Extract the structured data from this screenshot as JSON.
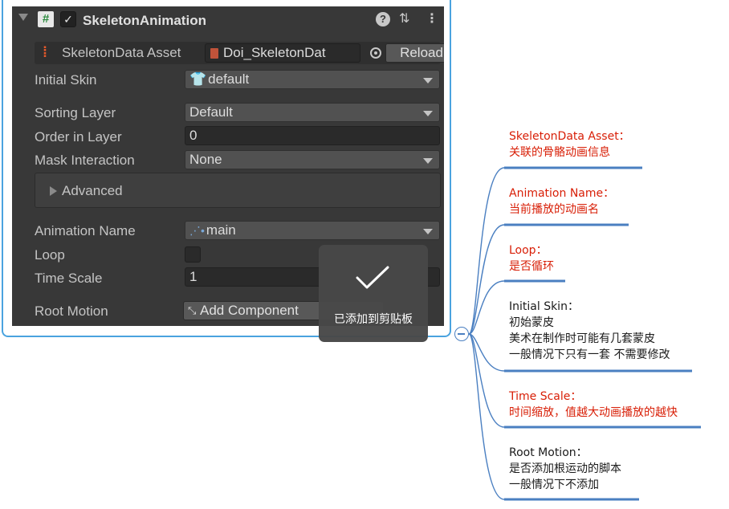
{
  "inspector": {
    "component_title": "SkeletonAnimation",
    "script_icon_glyph": "#",
    "enable_check_glyph": "✓",
    "help_icon_glyph": "?",
    "preset_icon_glyph": "⇅",
    "menu_icon_glyph": "⋮",
    "asset_row": {
      "label": "SkeletonData Asset",
      "value": "Doi_SkeletonDat",
      "reload_label": "Reload"
    },
    "initial_skin": {
      "label": "Initial Skin",
      "value": "default"
    },
    "sorting_layer": {
      "label": "Sorting Layer",
      "value": "Default"
    },
    "order_in_layer": {
      "label": "Order in Layer",
      "value": "0"
    },
    "mask_interaction": {
      "label": "Mask Interaction",
      "value": "None"
    },
    "advanced": {
      "label": "Advanced"
    },
    "animation_name": {
      "label": "Animation Name",
      "value": "main"
    },
    "loop": {
      "label": "Loop",
      "checked": false
    },
    "time_scale": {
      "label": "Time Scale",
      "value": "1"
    },
    "root_motion": {
      "label": "Root Motion",
      "button_label": "Add Component"
    }
  },
  "toast": {
    "message": "已添加到剪贴板"
  },
  "mindmap": {
    "branch_color": "#4a7fc1",
    "notes": [
      {
        "title": "SkeletonData Asset：",
        "lines": [
          "关联的骨骼动画信息"
        ],
        "color": "red"
      },
      {
        "title": "Animation Name：",
        "lines": [
          "当前播放的动画名"
        ],
        "color": "red"
      },
      {
        "title": "Loop：",
        "lines": [
          "是否循环"
        ],
        "color": "red"
      },
      {
        "title": "Initial Skin：",
        "lines": [
          "初始蒙皮",
          "美术在制作时可能有几套蒙皮",
          "一般情况下只有一套 不需要修改"
        ],
        "color": "black"
      },
      {
        "title": "Time Scale：",
        "lines": [
          "时间缩放，值越大动画播放的越快"
        ],
        "color": "red"
      },
      {
        "title": "Root Motion：",
        "lines": [
          "是否添加根运动的脚本",
          "一般情况下不添加"
        ],
        "color": "black"
      }
    ]
  },
  "colors": {
    "panel_bg": "#383838",
    "field_bg": "#515151",
    "highlight_border": "#4aa3df",
    "red_text": "#d81e06"
  }
}
